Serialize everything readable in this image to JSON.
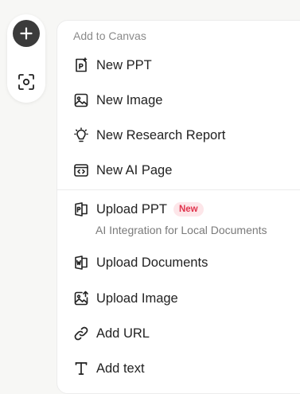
{
  "toolbar": {
    "buttons": [
      {
        "name": "add",
        "icon": "plus-icon"
      },
      {
        "name": "scan",
        "icon": "scan-icon"
      }
    ]
  },
  "menu": {
    "heading": "Add to Canvas",
    "items": [
      {
        "label": "New PPT",
        "icon": "ppt-icon"
      },
      {
        "label": "New Image",
        "icon": "image-icon"
      },
      {
        "label": "New Research Report",
        "icon": "lightbulb-icon"
      },
      {
        "label": "New AI Page",
        "icon": "code-page-icon"
      },
      {
        "label": "Upload PPT",
        "icon": "upload-ppt-icon",
        "badge": "New",
        "description": "AI Integration for Local Documents"
      },
      {
        "label": "Upload Documents",
        "icon": "word-doc-icon"
      },
      {
        "label": "Upload Image",
        "icon": "upload-image-icon"
      },
      {
        "label": "Add URL",
        "icon": "link-icon"
      },
      {
        "label": "Add text",
        "icon": "text-icon"
      }
    ]
  },
  "colors": {
    "badge_bg": "#fde6e9",
    "badge_text": "#e0344d",
    "add_button_bg": "#3b3b3b"
  }
}
